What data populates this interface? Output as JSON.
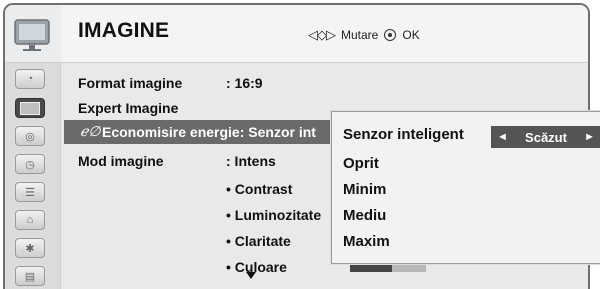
{
  "header": {
    "title": "IMAGINE",
    "nav_hint": "Mutare",
    "ok_hint": "OK"
  },
  "sidebar": {
    "items": [
      {
        "icon": "satellite-dish-icon",
        "active": false
      },
      {
        "icon": "tv-screen-icon",
        "active": true
      },
      {
        "icon": "speaker-icon",
        "active": false
      },
      {
        "icon": "clock-icon",
        "active": false
      },
      {
        "icon": "options-icon",
        "active": false
      },
      {
        "icon": "lock-icon",
        "active": false
      },
      {
        "icon": "usb-icon",
        "active": false
      },
      {
        "icon": "media-icon",
        "active": false
      }
    ]
  },
  "menu": {
    "format_label": "Format imagine",
    "format_value": ": 16:9",
    "expert_label": "Expert Imagine",
    "energy_label": "Economisire energie: Senzor int",
    "mode_label": "Mod imagine",
    "mode_value": ": Intens",
    "sub_items": [
      "• Contrast",
      "• Luminozitate",
      "• Claritate",
      "• Culoare"
    ],
    "culoare_level": 0.55
  },
  "popup": {
    "options": [
      "Senzor inteligent",
      "Oprit",
      "Minim",
      "Mediu",
      "Maxim"
    ],
    "selector_value": "Scăzut",
    "selector_left": "◄",
    "selector_right": "►"
  },
  "colors": {
    "highlight": "#6a6a6a",
    "selector": "#555555"
  }
}
